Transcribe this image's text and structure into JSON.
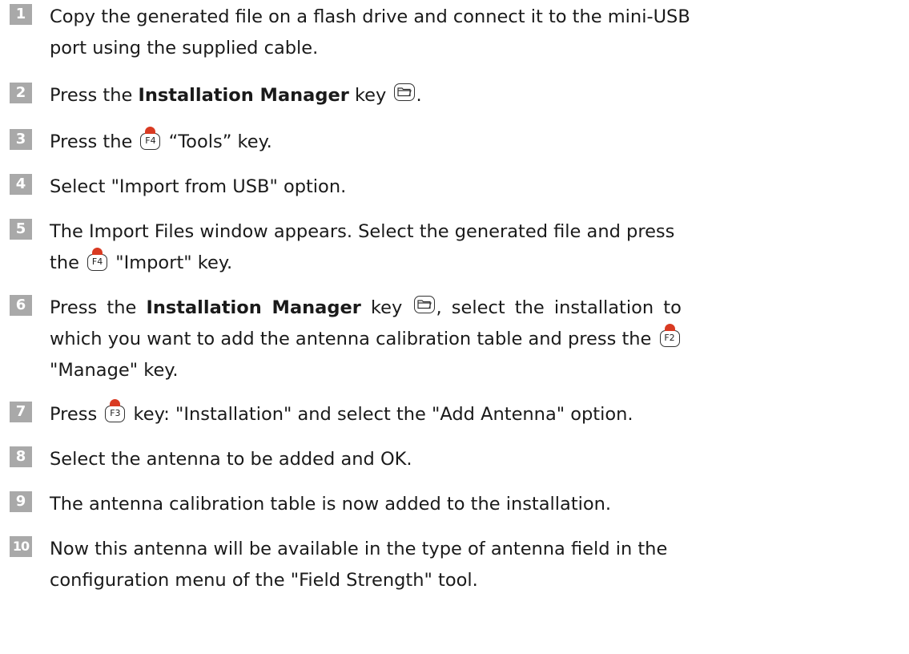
{
  "steps": [
    {
      "num": "1",
      "lines": [
        "Copy the generated file on a flash drive and connect it to the mini-USB",
        "port using the supplied cable."
      ]
    },
    {
      "num": "2",
      "a": "Press the ",
      "bold": "Installation Manager",
      "b": " key",
      "c": "."
    },
    {
      "num": "3",
      "a": "Press the",
      "key": "F4",
      "b": "“Tools” key."
    },
    {
      "num": "4",
      "text": "Select \"Import from USB\" option."
    },
    {
      "num": "5",
      "line1": "The Import Files window appears. Select the generated file and press",
      "a": "the",
      "key": "F4",
      "b": "\"Import\" key."
    },
    {
      "num": "6",
      "a": "Press the ",
      "bold": "Installation Manager",
      "b": " key",
      "c": ", select the installation to",
      "line2": "which you want to add the antenna calibration table and press the",
      "key": "F2",
      "line3": "\"Manage\" key."
    },
    {
      "num": "7",
      "a": "Press",
      "key": "F3",
      "b": "key: \"Installation\" and select the \"Add Antenna\" option."
    },
    {
      "num": "8",
      "text": "Select the antenna to be added and OK."
    },
    {
      "num": "9",
      "text": "The antenna calibration table is now added to the installation."
    },
    {
      "num": "10",
      "lines": [
        "Now this antenna will be available in the type of antenna field in the",
        "configuration menu of the \"Field Strength\" tool."
      ]
    }
  ]
}
